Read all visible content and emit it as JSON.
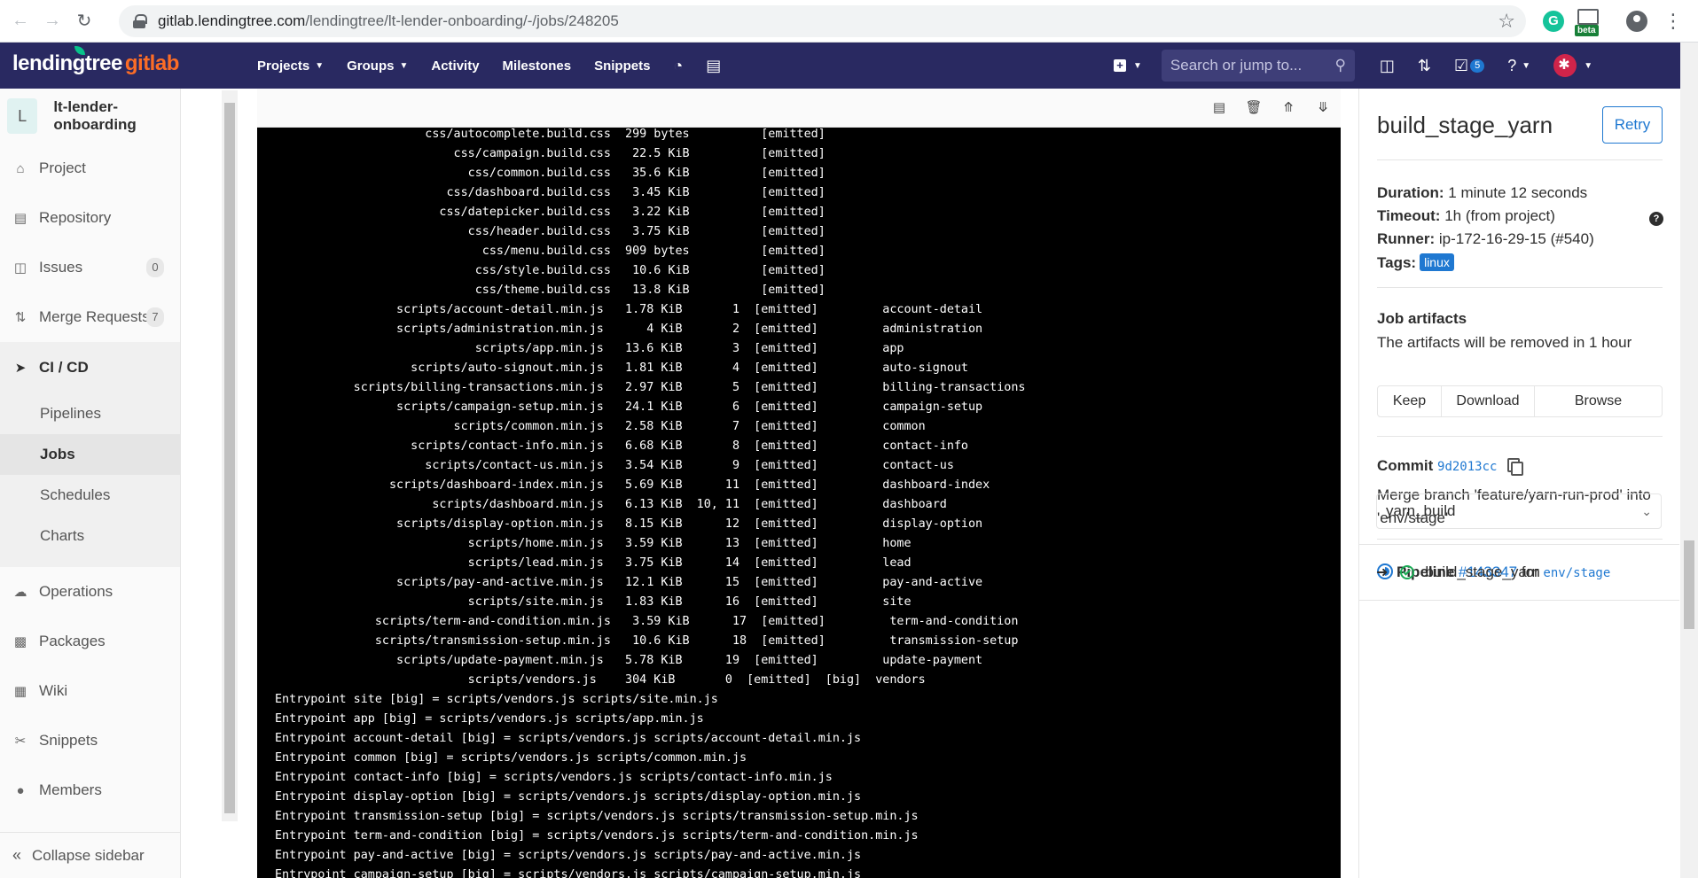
{
  "browser": {
    "url_host": "gitlab.lendingtree.com",
    "url_path": "/lendingtree/lt-lender-onboarding/-/jobs/248205",
    "ext_beta_label": "beta"
  },
  "brand": {
    "part1": "lendingtree",
    "part2": "gitlab"
  },
  "topnav": {
    "items": [
      "Projects",
      "Groups",
      "Activity",
      "Milestones",
      "Snippets"
    ],
    "search_placeholder": "Search or jump to...",
    "todos_count": "5"
  },
  "sidebar": {
    "project_initial": "L",
    "project_name": "lt-lender-onboarding",
    "items": [
      {
        "label": "Project",
        "icon": "home-icon"
      },
      {
        "label": "Repository",
        "icon": "doc-icon"
      },
      {
        "label": "Issues",
        "icon": "issues-icon",
        "count": "0"
      },
      {
        "label": "Merge Requests",
        "icon": "merge-request-icon",
        "count": "7"
      },
      {
        "label": "CI / CD",
        "icon": "rocket-icon"
      },
      {
        "label": "Operations",
        "icon": "cloud-gear-icon"
      },
      {
        "label": "Packages",
        "icon": "package-icon"
      },
      {
        "label": "Wiki",
        "icon": "book-icon"
      },
      {
        "label": "Snippets",
        "icon": "scissors-icon"
      },
      {
        "label": "Members",
        "icon": "users-icon"
      }
    ],
    "cicd_sub": [
      "Pipelines",
      "Jobs",
      "Schedules",
      "Charts"
    ],
    "collapse_label": "Collapse sidebar"
  },
  "log": {
    "lines": [
      "                     css/autocomplete.build.css  299 bytes          [emitted]",
      "                         css/campaign.build.css   22.5 KiB          [emitted]",
      "                           css/common.build.css   35.6 KiB          [emitted]",
      "                        css/dashboard.build.css   3.45 KiB          [emitted]",
      "                       css/datepicker.build.css   3.22 KiB          [emitted]",
      "                           css/header.build.css   3.75 KiB          [emitted]",
      "                             css/menu.build.css  909 bytes          [emitted]",
      "                            css/style.build.css   10.6 KiB          [emitted]",
      "                            css/theme.build.css   13.8 KiB          [emitted]",
      "                 scripts/account-detail.min.js   1.78 KiB       1  [emitted]         account-detail",
      "                 scripts/administration.min.js      4 KiB       2  [emitted]         administration",
      "                            scripts/app.min.js   13.6 KiB       3  [emitted]         app",
      "                   scripts/auto-signout.min.js   1.81 KiB       4  [emitted]         auto-signout",
      "           scripts/billing-transactions.min.js   2.97 KiB       5  [emitted]         billing-transactions",
      "                 scripts/campaign-setup.min.js   24.1 KiB       6  [emitted]         campaign-setup",
      "                         scripts/common.min.js   2.58 KiB       7  [emitted]         common",
      "                   scripts/contact-info.min.js   6.68 KiB       8  [emitted]         contact-info",
      "                     scripts/contact-us.min.js   3.54 KiB       9  [emitted]         contact-us",
      "                scripts/dashboard-index.min.js   5.69 KiB      11  [emitted]         dashboard-index",
      "                      scripts/dashboard.min.js   6.13 KiB  10, 11  [emitted]         dashboard",
      "                 scripts/display-option.min.js   8.15 KiB      12  [emitted]         display-option",
      "                           scripts/home.min.js   3.59 KiB      13  [emitted]         home",
      "                           scripts/lead.min.js   3.75 KiB      14  [emitted]         lead",
      "                 scripts/pay-and-active.min.js   12.1 KiB      15  [emitted]         pay-and-active",
      "                           scripts/site.min.js   1.83 KiB      16  [emitted]         site",
      "              scripts/term-and-condition.min.js   3.59 KiB      17  [emitted]         term-and-condition",
      "              scripts/transmission-setup.min.js   10.6 KiB      18  [emitted]         transmission-setup",
      "                 scripts/update-payment.min.js   5.78 KiB      19  [emitted]         update-payment",
      "                           scripts/vendors.js    304 KiB       0  [emitted]  [big]  vendors",
      "Entrypoint site [big] = scripts/vendors.js scripts/site.min.js",
      "Entrypoint app [big] = scripts/vendors.js scripts/app.min.js",
      "Entrypoint account-detail [big] = scripts/vendors.js scripts/account-detail.min.js",
      "Entrypoint common [big] = scripts/vendors.js scripts/common.min.js",
      "Entrypoint contact-info [big] = scripts/vendors.js scripts/contact-info.min.js",
      "Entrypoint display-option [big] = scripts/vendors.js scripts/display-option.min.js",
      "Entrypoint transmission-setup [big] = scripts/vendors.js scripts/transmission-setup.min.js",
      "Entrypoint term-and-condition [big] = scripts/vendors.js scripts/term-and-condition.min.js",
      "Entrypoint pay-and-active [big] = scripts/vendors.js scripts/pay-and-active.min.js",
      "Entrypoint campaign-setup [big] = scripts/vendors.js scripts/campaign-setup.min.js"
    ]
  },
  "job": {
    "name": "build_stage_yarn",
    "retry_label": "Retry",
    "duration_label": "Duration:",
    "duration_value": "1 minute 12 seconds",
    "timeout_label": "Timeout:",
    "timeout_value": "1h (from project)",
    "runner_label": "Runner:",
    "runner_value": "ip-172-16-29-15 (#540)",
    "tags_label": "Tags:",
    "tag": "linux",
    "artifacts_title": "Job artifacts",
    "artifacts_note": "The artifacts will be removed in 1 hour",
    "artifact_buttons": [
      "Keep",
      "Download",
      "Browse"
    ],
    "commit_label": "Commit",
    "commit_sha": "9d2013cc",
    "commit_message": "Merge branch 'feature/yarn-run-prod' into 'env/stage'",
    "pipeline_label": "Pipeline",
    "pipeline_id": "#143347",
    "pipeline_for": "for",
    "pipeline_ref": "env/stage",
    "stage_selected": "yarn_build",
    "current_job": "build_stage_yarn"
  },
  "colors": {
    "navbar": "#292961",
    "accent": "#1f78d1",
    "success": "#1aaa55",
    "brand_orange": "#fc6d26"
  }
}
